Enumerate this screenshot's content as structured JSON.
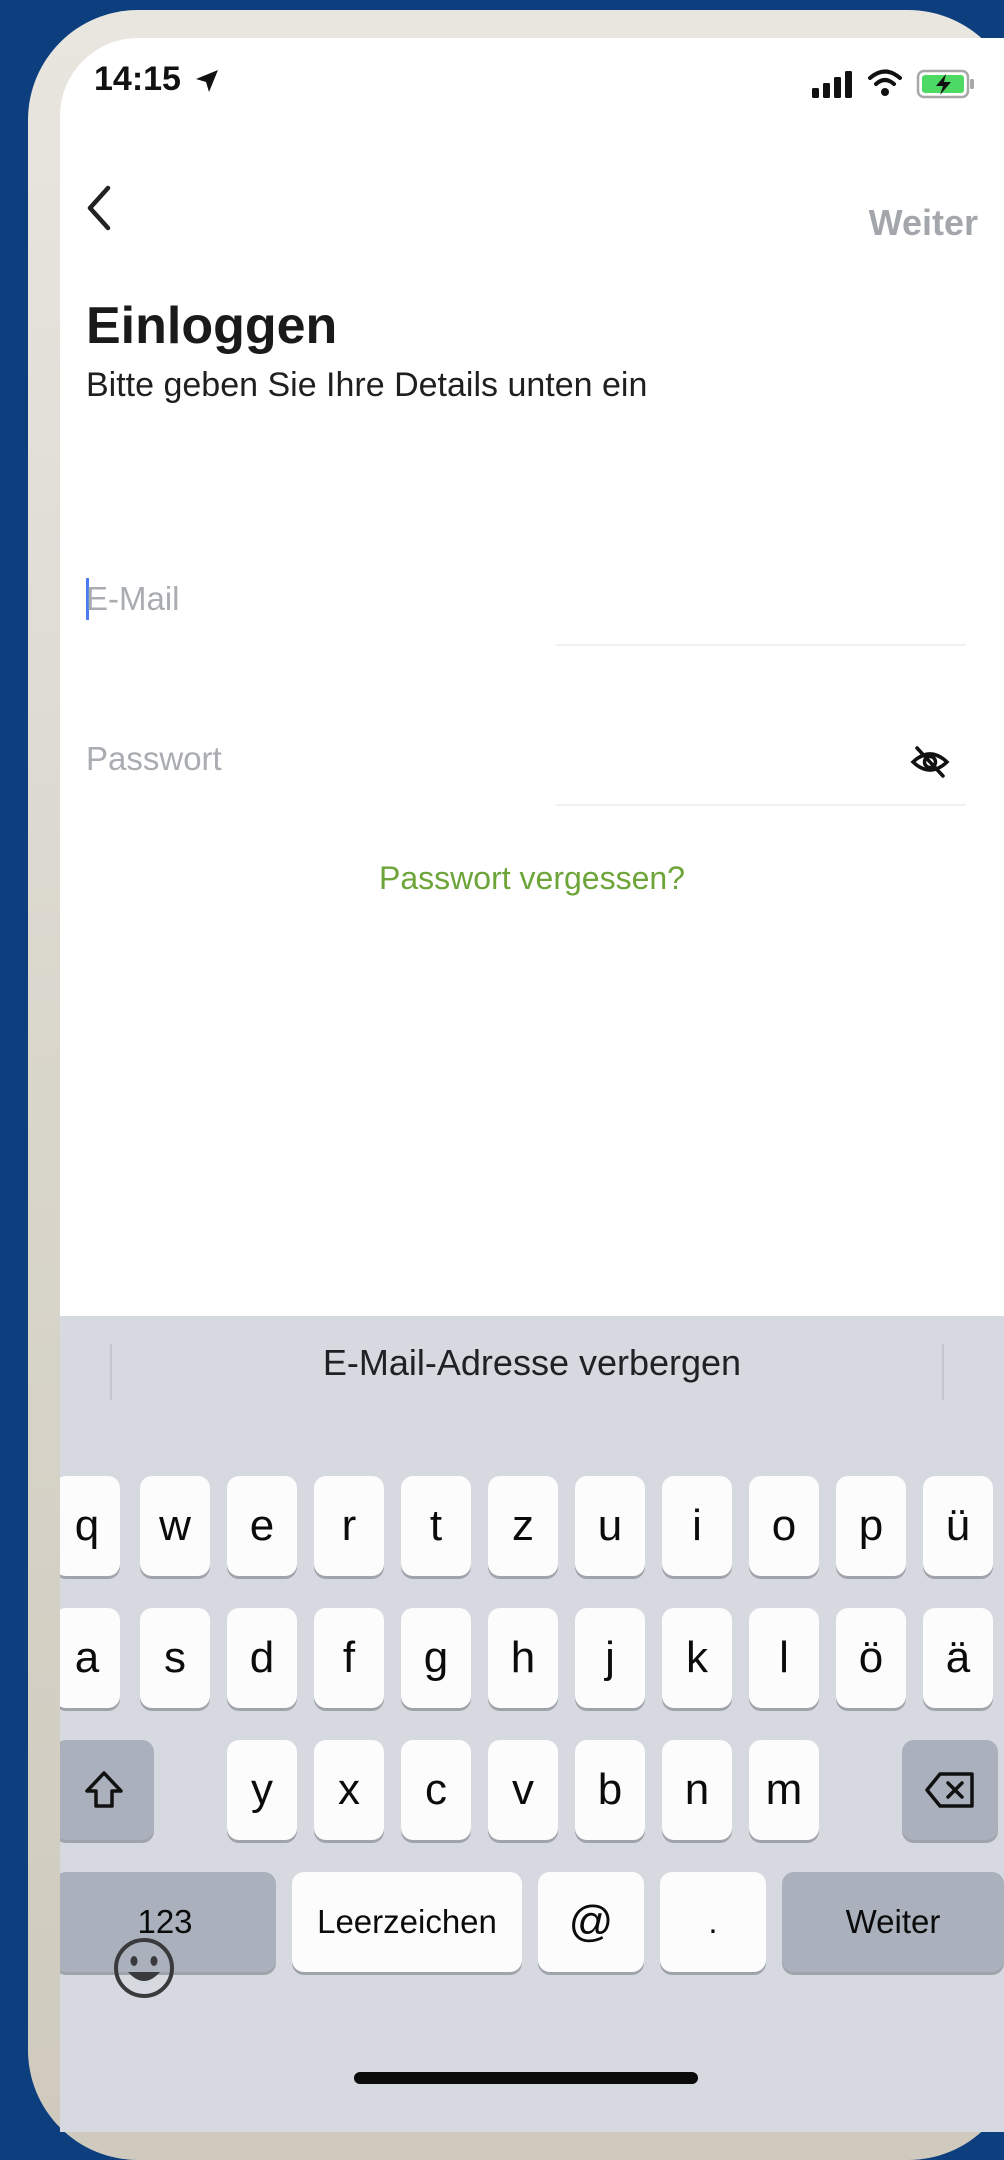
{
  "status_bar": {
    "time": "14:15",
    "icons": [
      "location-arrow-icon",
      "cellular-signal-icon",
      "wifi-icon",
      "battery-charging-icon"
    ],
    "battery_color": "#4cd964"
  },
  "nav": {
    "back_icon": "chevron-left-icon",
    "next_label": "Weiter"
  },
  "header": {
    "title": "Einloggen",
    "subtitle": "Bitte geben Sie Ihre Details unten ein"
  },
  "form": {
    "email": {
      "value": "",
      "placeholder": "E-Mail"
    },
    "password": {
      "value": "",
      "placeholder": "Passwort",
      "toggle_icon": "eye-slash-icon"
    },
    "forgot_label": "Passwort vergessen?",
    "accent_color": "#6ea53a"
  },
  "keyboard": {
    "suggestion": "E-Mail-Adresse verbergen",
    "row1": [
      "q",
      "w",
      "e",
      "r",
      "t",
      "z",
      "u",
      "i",
      "o",
      "p",
      "ü"
    ],
    "row2": [
      "a",
      "s",
      "d",
      "f",
      "g",
      "h",
      "j",
      "k",
      "l",
      "ö",
      "ä"
    ],
    "row3": [
      "y",
      "x",
      "c",
      "v",
      "b",
      "n",
      "m"
    ],
    "shift_icon": "shift-arrow-icon",
    "delete_icon": "delete-backspace-icon",
    "numbers_label": "123",
    "space_label": "Leerzeichen",
    "at_label": "@",
    "dot_label": ".",
    "return_label": "Weiter",
    "emoji_icon": "emoji-smiley-icon"
  }
}
